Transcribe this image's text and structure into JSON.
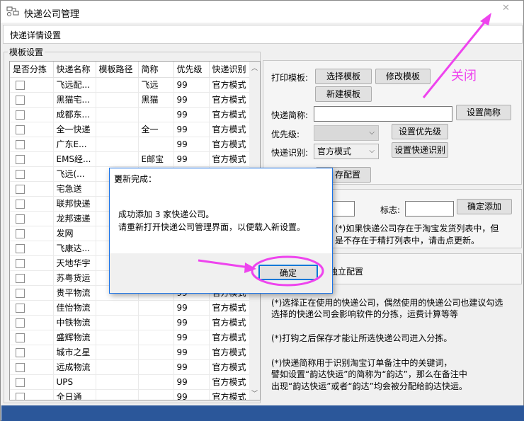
{
  "window": {
    "title": "快递公司管理",
    "close_glyph": "✕"
  },
  "section": {
    "title": "快递详情设置"
  },
  "template_group": {
    "legend": "模板设置"
  },
  "grid": {
    "columns": [
      "是否分拣",
      "快递名称",
      "模板路径",
      "简称",
      "优先级",
      "快递识别"
    ],
    "rows": [
      {
        "name": "飞远配...",
        "abbr": "飞远",
        "priority": "99",
        "ident": "官方模式"
      },
      {
        "name": "黑猫宅...",
        "abbr": "黑猫",
        "priority": "99",
        "ident": "官方模式"
      },
      {
        "name": "成都东...",
        "abbr": "",
        "priority": "99",
        "ident": "官方模式"
      },
      {
        "name": "全一快递",
        "abbr": "全一",
        "priority": "99",
        "ident": "官方模式"
      },
      {
        "name": "广东E...",
        "abbr": "",
        "priority": "99",
        "ident": "官方模式"
      },
      {
        "name": "EMS经...",
        "abbr": "E邮宝",
        "priority": "99",
        "ident": "官方模式"
      },
      {
        "name": "飞远(...",
        "abbr": "",
        "priority": "",
        "ident": ""
      },
      {
        "name": "宅急送",
        "abbr": "",
        "priority": "",
        "ident": ""
      },
      {
        "name": "联邦快递",
        "abbr": "",
        "priority": "",
        "ident": ""
      },
      {
        "name": "龙邦速递",
        "abbr": "",
        "priority": "",
        "ident": ""
      },
      {
        "name": "发网",
        "abbr": "",
        "priority": "",
        "ident": ""
      },
      {
        "name": "飞康达...",
        "abbr": "",
        "priority": "",
        "ident": ""
      },
      {
        "name": "天地华宇",
        "abbr": "",
        "priority": "",
        "ident": ""
      },
      {
        "name": "苏粤货运",
        "abbr": "",
        "priority": "",
        "ident": ""
      },
      {
        "name": "贵平物流",
        "abbr": "",
        "priority": "99",
        "ident": "官方模式"
      },
      {
        "name": "佳怡物流",
        "abbr": "",
        "priority": "99",
        "ident": "官方模式"
      },
      {
        "name": "中铁物流",
        "abbr": "",
        "priority": "99",
        "ident": "官方模式"
      },
      {
        "name": "盛辉物流",
        "abbr": "",
        "priority": "99",
        "ident": "官方模式"
      },
      {
        "name": "城市之星",
        "abbr": "",
        "priority": "99",
        "ident": "官方模式"
      },
      {
        "name": "远成物流",
        "abbr": "",
        "priority": "99",
        "ident": "官方模式"
      },
      {
        "name": "UPS",
        "abbr": "",
        "priority": "99",
        "ident": "官方模式"
      },
      {
        "name": "全日通",
        "abbr": "",
        "priority": "99",
        "ident": "官方模式"
      }
    ]
  },
  "right_panel": {
    "print_template_label": "打印模板:",
    "select_template": "选择模板",
    "modify_template": "修改模板",
    "new_template": "新建模板",
    "abbr_label": "快递简称:",
    "set_abbr": "设置简称",
    "priority_label": "优先级:",
    "set_priority": "设置优先级",
    "ident_label": "快递识别:",
    "ident_value": "官方模式",
    "set_ident": "设置快递识别",
    "save_config_partial": "存配置",
    "flag_label": "标志:",
    "confirm_add": "确定添加",
    "hint_line1": "(*)如果快递公司存在于淘宝发货列表中，但",
    "hint_line2": "是不存在于精打列表中，请击点更新。",
    "independent_partial": "用独立配置",
    "notes": [
      "(*)选择正在使用的快递公司，偶然使用的快递公司也建议勾选",
      "选择的快递公司会影响软件的分拣，运费计算等等",
      "(*)打钩之后保存才能让所选快递公司进入分拣。",
      "(*)快递简称用于识别淘宝订单备注中的关键词，",
      "譬如设置“韵达快运”的简称为“韵达”，那么在备注中",
      "出现“韵达快运”或者“韵达”均会被分配给韵达快运。"
    ]
  },
  "dialog": {
    "title": "更新完成：",
    "message_line1": "成功添加 3 家快递公司。",
    "message_line2": "请重新打开快递公司管理界面，以便载入新设置。",
    "ok": "确定"
  },
  "annotation": {
    "close_label": "关闭",
    "color": "#ee44ee"
  }
}
